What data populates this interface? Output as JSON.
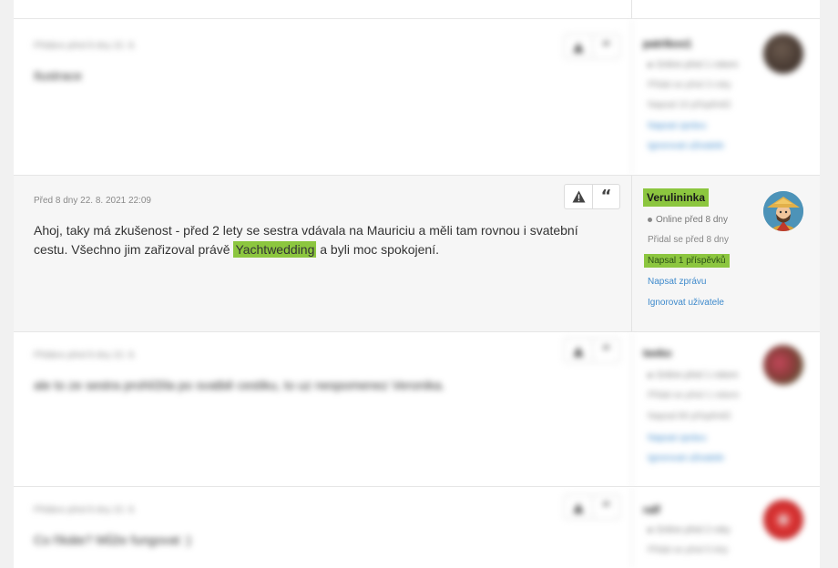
{
  "posts": [
    {
      "date": "Přidáno před 8 dny 22. 8.",
      "text": "Ilustrace",
      "user": {
        "name": "patrikos1",
        "status": "Online před 1 rokem",
        "joined": "Přidal se před 3 roky",
        "posts": "Napsal 10 příspěvků",
        "message": "Napsat zprávu",
        "ignore": "Ignorovat uživatele"
      }
    },
    {
      "date": "Před 8 dny 22. 8. 2021 22:09",
      "text_before": "Ahoj, taky má zkušenost - před 2 lety se sestra vdávala na Mauriciu a měli tam rovnou i svatební cestu. Všechno jim zařizoval právě ",
      "text_highlight": "Yachtwedding",
      "text_after": " a byli moc spokojení.",
      "user": {
        "name": "Verulininka",
        "status": "Online před 8 dny",
        "joined": "Přidal se před 8 dny",
        "posts": "Napsal 1 příspěvků",
        "message": "Napsat zprávu",
        "ignore": "Ignorovat uživatele"
      }
    },
    {
      "date": "Přidáno před 8 dny 22. 8.",
      "text": "ale to ze sestra prohlížila po svatbě cestiku, to uz nespomenez Veronika.",
      "user": {
        "name": "teeko",
        "status": "Online před 1 rokem",
        "joined": "Přidal se před 1 rokem",
        "posts": "Napsal 80 příspěvků",
        "message": "Napsat zprávu",
        "ignore": "Ignorovat uživatele"
      }
    },
    {
      "date": "Přidáno před 8 dny 22. 8.",
      "text": "Co říkáte? Může fungovat :)",
      "user": {
        "name": "ralf",
        "status": "Online před 2 roky",
        "joined": "Přidal se před 5 lety"
      }
    }
  ]
}
